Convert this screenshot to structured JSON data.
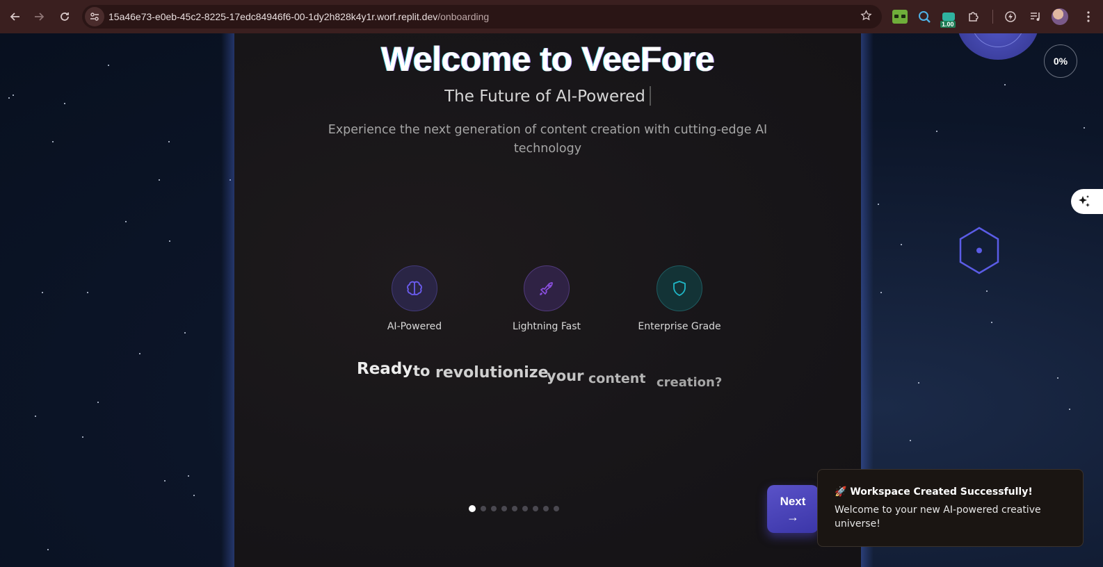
{
  "browser": {
    "url_host": "15a46e73-e0eb-45c2-8225-17edc84946f6-00-1dy2h828k4y1r.worf.replit.dev",
    "url_path": "/onboarding",
    "back_icon": "arrow-left-icon",
    "forward_icon": "arrow-right-icon",
    "reload_icon": "reload-icon",
    "site_info_icon": "tune-icon",
    "bookmark_icon": "star-icon",
    "extension_badge": "1.00"
  },
  "hero": {
    "title": "Welcome to VeeFore",
    "subtitle": "The Future of AI-Powered",
    "description": "Experience the next generation of content creation with cutting-edge AI technology"
  },
  "features": [
    {
      "label": "AI-Powered",
      "icon": "brain-icon",
      "color": "#6b5cf0"
    },
    {
      "label": "Lightning Fast",
      "icon": "rocket-icon",
      "color": "#8b4fe0"
    },
    {
      "label": "Enterprise Grade",
      "icon": "shield-icon",
      "color": "#1fb8c8"
    }
  ],
  "tagline": {
    "words": [
      "Ready",
      "to",
      "revolutionize",
      "your",
      "content",
      "creation?"
    ]
  },
  "pagination": {
    "total": 9,
    "active": 1
  },
  "progress": {
    "label": "0%",
    "value": 0
  },
  "next_button": {
    "label": "Next",
    "arrow": "→"
  },
  "toast": {
    "emoji": "🚀",
    "title": "Workspace Created Successfully!",
    "body": "Welcome to your new AI-powered creative universe!"
  },
  "colors": {
    "accent": "#5a52c8",
    "brain": "#6b5cf0",
    "rocket": "#8b4fe0",
    "shield": "#1fb8c8"
  }
}
